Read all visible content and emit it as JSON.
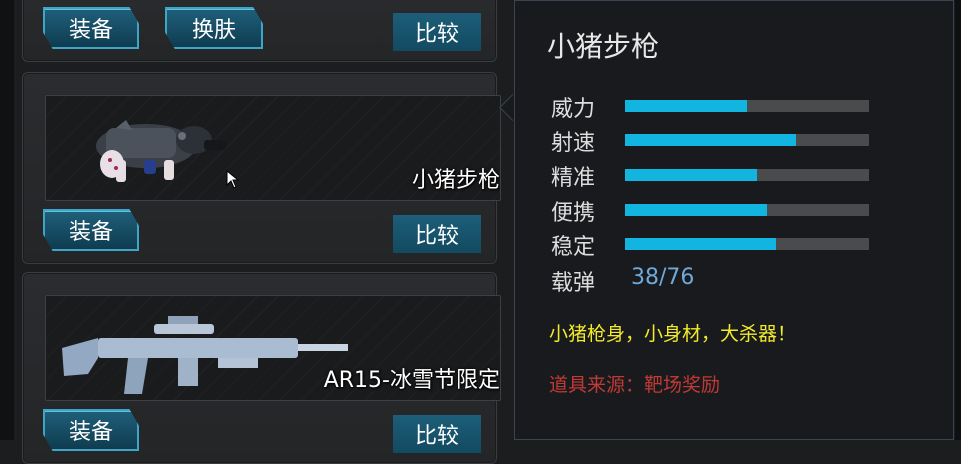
{
  "cards": [
    {
      "name": "",
      "equip_label": "装备",
      "skin_label": "换肤",
      "compare_label": "比较"
    },
    {
      "name": "小猪步枪",
      "equip_label": "装备",
      "compare_label": "比较"
    },
    {
      "name": "AR15-冰雪节限定",
      "equip_label": "装备",
      "compare_label": "比较"
    }
  ],
  "tooltip": {
    "title": "小猪步枪",
    "stats": [
      {
        "label": "威力",
        "value": 0.5
      },
      {
        "label": "射速",
        "value": 0.7
      },
      {
        "label": "精准",
        "value": 0.54
      },
      {
        "label": "便携",
        "value": 0.58
      },
      {
        "label": "稳定",
        "value": 0.62
      }
    ],
    "ammo_label": "载弹",
    "ammo_value": "38/76",
    "description": "小猪枪身，小身材，大杀器！",
    "source": "道具来源：靶场奖励"
  },
  "colors": {
    "bar_fill": "#12b5e0",
    "bar_track": "#4a4b4d",
    "description": "#f2ea2c",
    "source": "#c03a35",
    "ammo": "#6fa9d8"
  }
}
